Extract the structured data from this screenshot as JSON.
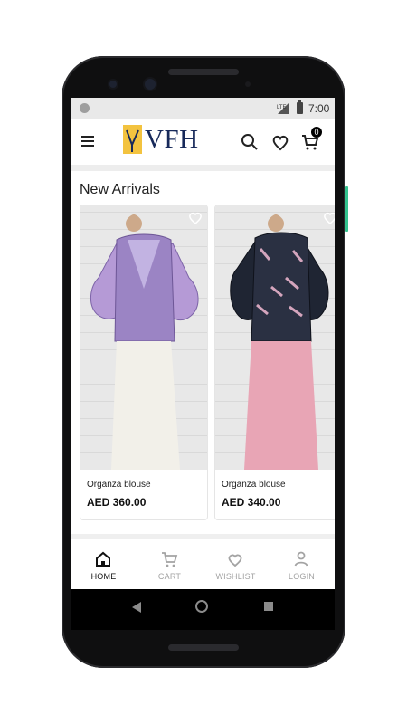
{
  "status": {
    "network": "LTE",
    "time": "7:00"
  },
  "header": {
    "logo_text": "VFH",
    "cart_count": "0"
  },
  "section": {
    "title": "New Arrivals"
  },
  "products": [
    {
      "name": "Organza blouse",
      "price": "AED 360.00"
    },
    {
      "name": "Organza blouse",
      "price": "AED 340.00"
    }
  ],
  "bottom_nav": {
    "items": [
      {
        "label": "HOME",
        "icon": "home-icon",
        "active": true
      },
      {
        "label": "CART",
        "icon": "cart-icon",
        "active": false
      },
      {
        "label": "WISHLIST",
        "icon": "heart-icon",
        "active": false
      },
      {
        "label": "LOGIN",
        "icon": "user-icon",
        "active": false
      }
    ]
  },
  "colors": {
    "accent": "#f3c33f",
    "brand": "#17295a",
    "muted": "#a3a3a3"
  }
}
